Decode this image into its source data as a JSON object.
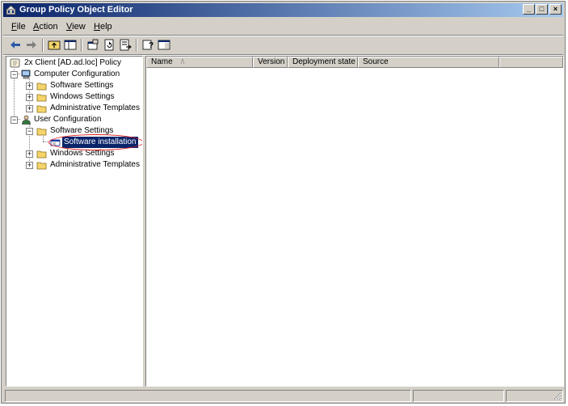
{
  "window": {
    "title": "Group Policy Object Editor",
    "controls": [
      "_",
      "□",
      "×"
    ]
  },
  "menu": [
    {
      "key": "F",
      "rest": "ile"
    },
    {
      "key": "A",
      "rest": "ction"
    },
    {
      "key": "V",
      "rest": "iew"
    },
    {
      "key": "H",
      "rest": "elp"
    }
  ],
  "toolbar": {
    "icons": [
      "back-arrow-icon",
      "forward-arrow-icon",
      "up-folder-icon",
      "show-hide-tree-icon",
      "properties-icon",
      "refresh-icon",
      "export-list-icon",
      "help-icon",
      "show-hide-action-pane-icon"
    ]
  },
  "tree": {
    "root": "2x Client [AD.ad.loc] Policy",
    "computer_config": "Computer Configuration",
    "cc_software_settings": "Software Settings",
    "cc_windows_settings": "Windows Settings",
    "cc_admin_templates": "Administrative Templates",
    "user_config": "User Configuration",
    "uc_software_settings": "Software Settings",
    "uc_software_installation": "Software installation",
    "uc_windows_settings": "Windows Settings",
    "uc_admin_templates": "Administrative Templates"
  },
  "list": {
    "columns": [
      "Name",
      "Version",
      "Deployment state",
      "Source"
    ],
    "sort_indicator": "/\\"
  },
  "colors": {
    "title_start": "#0a246a",
    "title_end": "#a6caf0",
    "selection": "#0a246a",
    "annotation": "#e21a1a",
    "face": "#d4d0c8",
    "folder": "#f5d56b"
  }
}
